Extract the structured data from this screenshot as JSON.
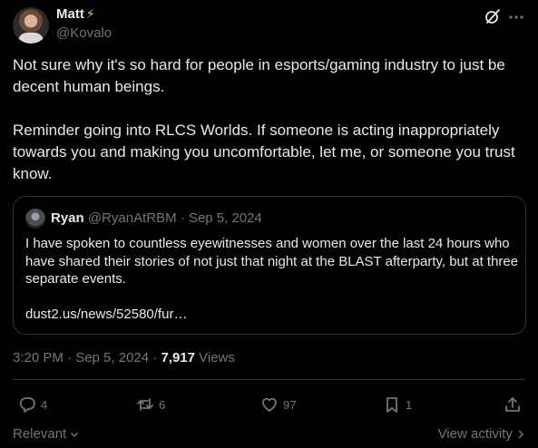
{
  "author": {
    "display_name": "Matt",
    "badge": "⚡",
    "handle": "@Kovalo"
  },
  "tweet": {
    "paragraphs": [
      "Not sure why it's so hard for people in esports/gaming industry to just be decent human beings.",
      "Reminder going into RLCS Worlds. If someone is acting inappropriately towards you and making you uncomfortable, let me, or someone you trust know."
    ]
  },
  "quote": {
    "name": "Ryan",
    "meta": "@RyanAtRBM · Sep 5, 2024",
    "text": "I have spoken to countless eyewitnesses and women over the last 24 hours who have shared their stories of not just that night at the BLAST afterparty, but at three separate events.",
    "link": "dust2.us/news/52580/fur…"
  },
  "meta": {
    "time_date": "3:20 PM · Sep 5, 2024 · ",
    "views_count": "7,917",
    "views_label": " Views"
  },
  "actions": {
    "replies": "4",
    "reposts": "6",
    "likes": "97",
    "bookmarks": "1"
  },
  "footer": {
    "sort_label": "Relevant",
    "view_activity": "View activity"
  },
  "icons": [
    "grok-icon",
    "more-icon",
    "reply-icon",
    "repost-icon",
    "like-icon",
    "bookmark-icon",
    "share-icon",
    "chevron-down-icon",
    "chevron-right-icon"
  ],
  "colors": {
    "background": "#000000",
    "text": "#e7e9ea",
    "muted": "#71767b",
    "border": "#2f3336",
    "badge": "#f5c33b"
  }
}
